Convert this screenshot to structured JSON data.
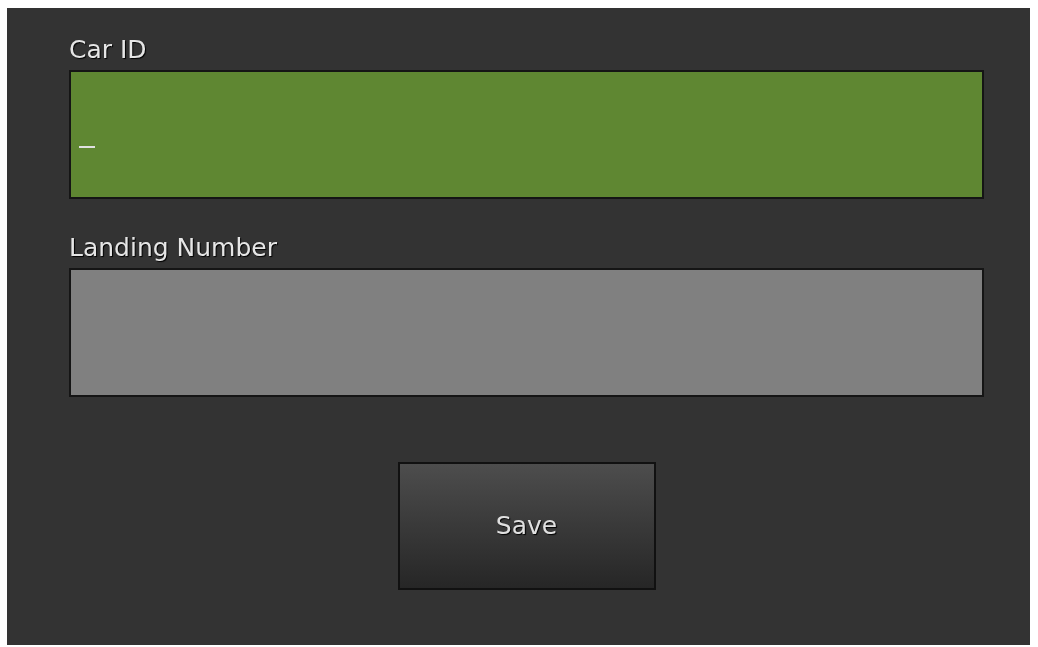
{
  "fields": [
    {
      "label": "Car ID",
      "focused": true
    },
    {
      "label": "Landing Number",
      "focused": false
    }
  ],
  "buttons": [
    "Save"
  ]
}
